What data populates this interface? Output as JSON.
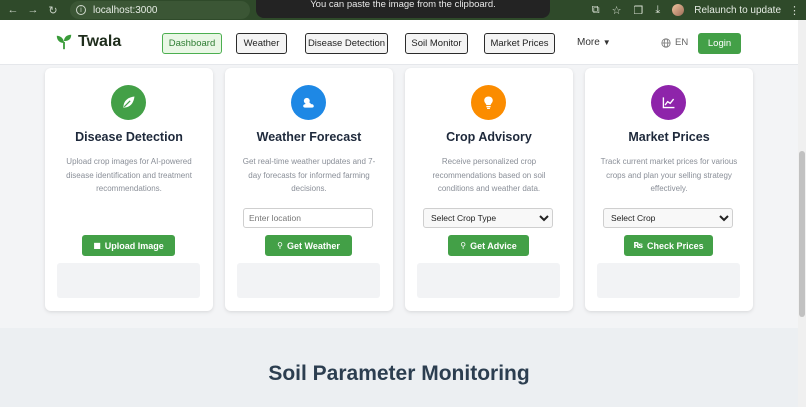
{
  "browser": {
    "url": "localhost:3000",
    "tooltip": "You can paste the image from the clipboard.",
    "relaunch_label": "Relaunch to update"
  },
  "nav": {
    "brand": "Twala",
    "items": [
      {
        "label": "Dashboard",
        "active": true
      },
      {
        "label": "Weather",
        "active": false
      },
      {
        "label": "Disease Detection",
        "active": false
      },
      {
        "label": "Soil Monitor",
        "active": false
      },
      {
        "label": "Market Prices",
        "active": false
      }
    ],
    "more_label": "More",
    "language": "EN",
    "login_label": "Login"
  },
  "cards": [
    {
      "title": "Disease Detection",
      "description": "Upload crop images for AI-powered disease identification and treatment recommendations.",
      "icon": "leaf-icon",
      "color": "#43a047",
      "button_label": "Upload Image",
      "button_icon": "camera-icon"
    },
    {
      "title": "Weather Forecast",
      "description": "Get real-time weather updates and 7-day forecasts for informed farming decisions.",
      "icon": "cloud-sun-icon",
      "color": "#1e88e5",
      "input_placeholder": "Enter location",
      "button_label": "Get Weather",
      "button_icon": "search-icon"
    },
    {
      "title": "Crop Advisory",
      "description": "Receive personalized crop recommendations based on soil conditions and weather data.",
      "icon": "lightbulb-icon",
      "color": "#fb8c00",
      "select_value": "Select Crop Type",
      "button_label": "Get Advice",
      "button_icon": "search-icon"
    },
    {
      "title": "Market Prices",
      "description": "Track current market prices for various crops and plan your selling strategy effectively.",
      "icon": "chart-line-icon",
      "color": "#8e24aa",
      "select_value": "Select Crop",
      "button_label": "Check Prices",
      "button_icon": "price-tag-icon"
    }
  ],
  "soil_section": {
    "title": "Soil Parameter Monitoring"
  }
}
